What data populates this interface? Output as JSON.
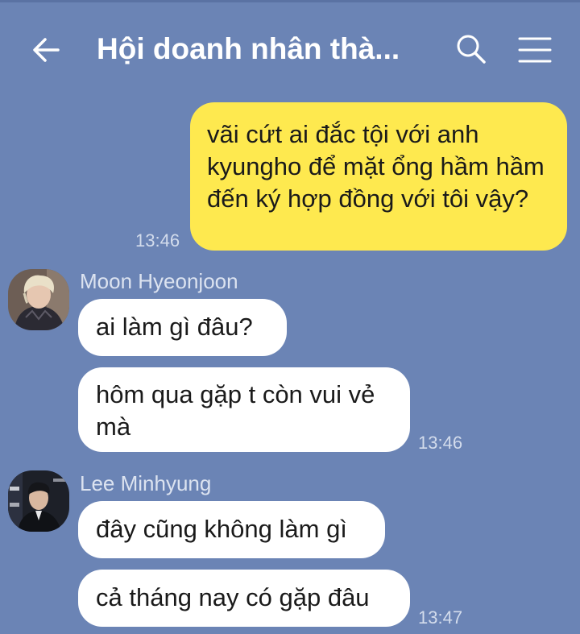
{
  "header": {
    "title": "Hội doanh nhân thà...",
    "icons": [
      "back-arrow-icon",
      "search-icon",
      "menu-icon"
    ]
  },
  "messages": {
    "m1": {
      "text": "vãi cứt ai đắc tội với anh kyungho để mặt ổng hầm hầm đến ký hợp đồng với tôi vậy?",
      "time": "13:46"
    },
    "g1": {
      "sender": "Moon Hyeonjoon",
      "b1": "ai làm gì đâu?",
      "b2": "hôm qua gặp t còn vui vẻ mà",
      "time": "13:46"
    },
    "g2": {
      "sender": "Lee Minhyung",
      "b1": "đây cũng không làm gì",
      "b2": "cả tháng nay có gặp đâu",
      "time": "13:47"
    }
  },
  "colors": {
    "background": "#6b84b5",
    "my_bubble": "#fee94f",
    "other_bubble": "#ffffff"
  }
}
